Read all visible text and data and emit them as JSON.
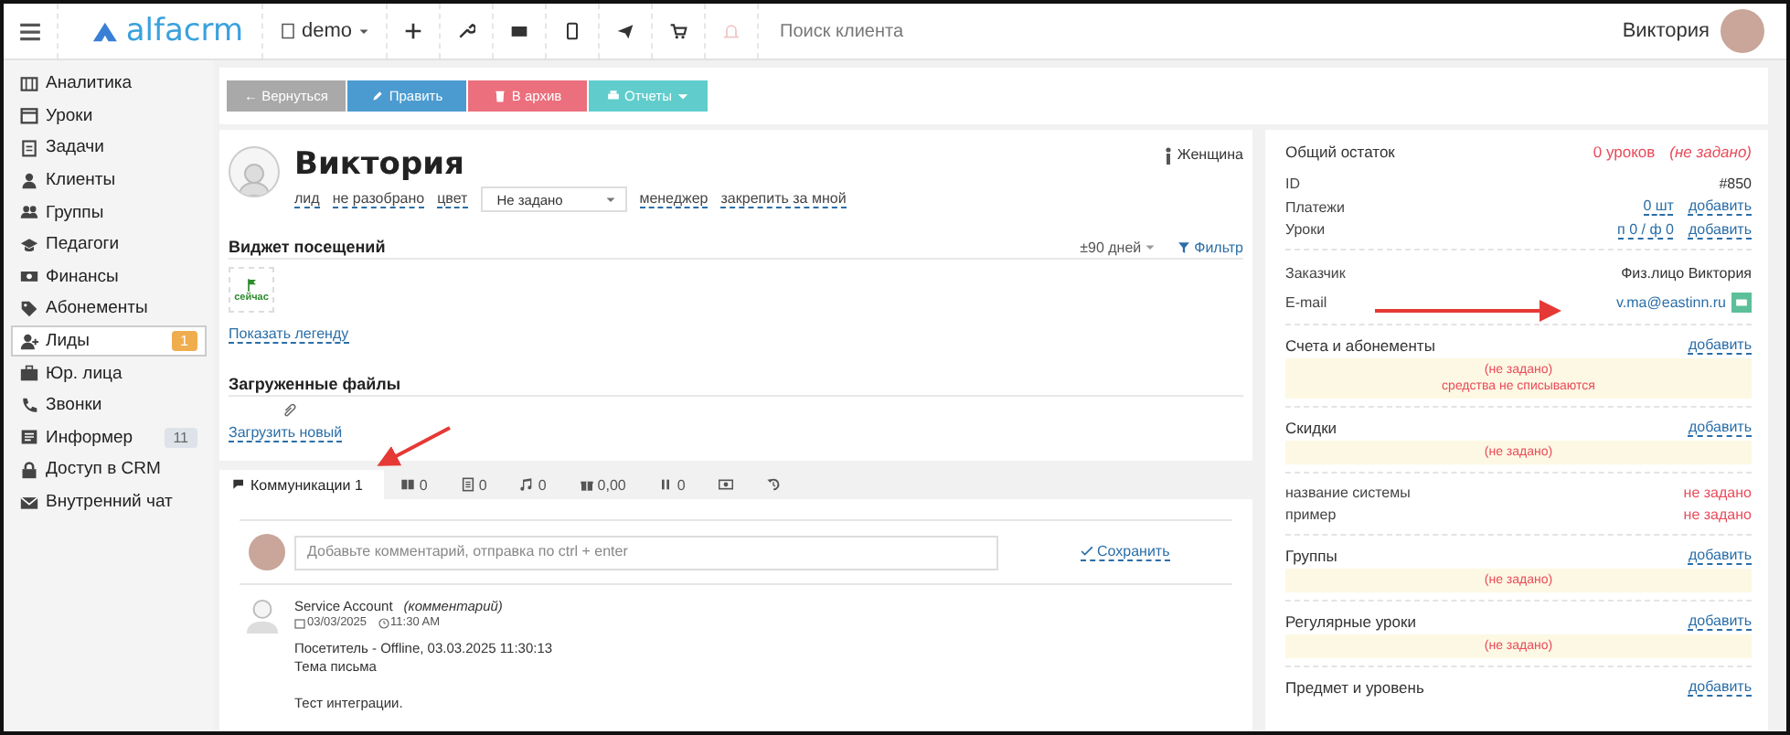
{
  "topbar": {
    "logo": "alfacrm",
    "branch": "demo",
    "search": {
      "placeholder": "Поиск клиента"
    },
    "user": "Виктория"
  },
  "sidebar": {
    "items": [
      {
        "label": "Аналитика",
        "selected": false
      },
      {
        "label": "Уроки",
        "selected": false
      },
      {
        "label": "Задачи",
        "selected": false
      },
      {
        "label": "Клиенты",
        "selected": false
      },
      {
        "label": "Группы",
        "selected": false
      },
      {
        "label": "Педагоги",
        "selected": false
      },
      {
        "label": "Финансы",
        "selected": false
      },
      {
        "label": "Абонементы",
        "selected": false
      },
      {
        "label": "Лиды",
        "selected": true,
        "badge": {
          "text": "1",
          "color": "#f0ad4e"
        }
      },
      {
        "label": "Юр. лица",
        "selected": false
      },
      {
        "label": "Звонки",
        "selected": false
      },
      {
        "label": "Информер",
        "selected": false,
        "badge": {
          "text": "11",
          "color": "#dde3e8"
        }
      },
      {
        "label": "Доступ в CRM",
        "selected": false
      },
      {
        "label": "Внутренний чат",
        "selected": false
      }
    ]
  },
  "actions": [
    {
      "kind": "back",
      "label": "← Вернуться"
    },
    {
      "kind": "edit",
      "label": "Править"
    },
    {
      "kind": "archive",
      "label": "В архив"
    },
    {
      "kind": "reports",
      "label": "Отчеты"
    }
  ],
  "profile": {
    "name": "Виктория",
    "gender": "Женщина",
    "fields": [
      "лид",
      "не разобрано",
      "цвет"
    ],
    "color_select": "Не задано",
    "fields_after": [
      "менеджер",
      "закрепить за мной"
    ]
  },
  "visits": {
    "title": "Виджет посещений",
    "range": "±90 дней",
    "filter": "Фильтр",
    "tile": "сейчас",
    "legend_link": "Показать легенду"
  },
  "files": {
    "title": "Загруженные файлы",
    "upload_link": "Загрузить новый"
  },
  "tabs": [
    {
      "label": "Коммуникации 1",
      "selected": true
    },
    {
      "label": "0",
      "selected": false
    },
    {
      "label": "0",
      "selected": false
    },
    {
      "label": "0",
      "selected": false
    },
    {
      "label": "0,00",
      "selected": false
    },
    {
      "label": "0",
      "selected": false
    },
    {
      "selected": false
    },
    {
      "selected": false
    }
  ],
  "comment_form": {
    "placeholder": "Добавьте комментарий, отправка по ctrl + enter",
    "save": "Сохранить"
  },
  "feed": [
    {
      "author": "Service Account",
      "type": "(комментарий)",
      "date": "03/03/2025",
      "time": "11:30 AM",
      "paragraphs": [
        [
          "Посетитель - Offline, 03.03.2025 11:30:13",
          "Тема письма"
        ],
        [
          "Тест интеграции."
        ]
      ]
    }
  ],
  "summary": {
    "title": "Общий остаток",
    "lessons": "0 уроков",
    "status": "(не задано)",
    "rows": [
      {
        "label": "ID",
        "value": "#850"
      },
      {
        "label": "Платежи",
        "value": "0 шт",
        "action": "добавить"
      },
      {
        "label": "Уроки",
        "value": "п 0 / ф 0",
        "action": "добавить"
      }
    ],
    "customer": [
      {
        "kind": "text",
        "label": "Заказчик",
        "value": "Физ.лицо Виктория"
      },
      {
        "kind": "email",
        "label": "E-mail",
        "value": "v.ma@eastinn.ru"
      }
    ]
  },
  "sections": [
    {
      "kind": "box",
      "title": "Счета и абонементы",
      "action": "добавить",
      "empty": [
        "(не задано)",
        "средства не списываются"
      ]
    },
    {
      "kind": "box",
      "title": "Скидки",
      "action": "добавить",
      "empty": [
        "(не задано)"
      ]
    },
    {
      "kind": "fields",
      "rows": [
        {
          "label": "название системы",
          "value": "не задано"
        },
        {
          "label": "пример",
          "value": "не задано"
        }
      ]
    },
    {
      "kind": "box",
      "title": "Группы",
      "action": "добавить",
      "empty": [
        "(не задано)"
      ]
    },
    {
      "kind": "box",
      "title": "Регулярные уроки",
      "action": "добавить",
      "empty": [
        "(не задано)"
      ]
    },
    {
      "kind": "box",
      "title": "Предмет и уровень",
      "action": "добавить"
    }
  ]
}
